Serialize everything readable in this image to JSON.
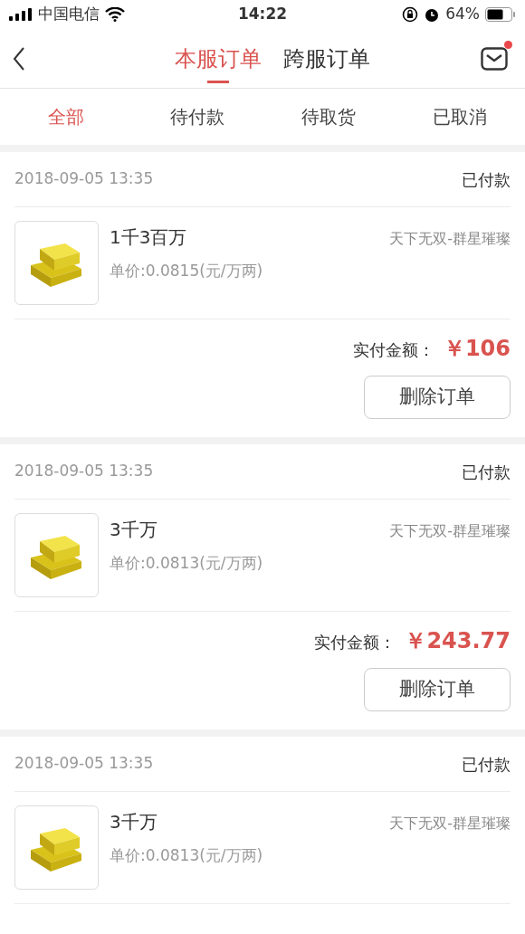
{
  "status_bar": {
    "carrier": "中国电信",
    "time": "14:22",
    "battery": "64%"
  },
  "header": {
    "tabs": [
      {
        "label": "本服订单",
        "selected": true
      },
      {
        "label": "跨服订单",
        "selected": false
      }
    ],
    "has_unread": true
  },
  "filters": [
    {
      "label": "全部",
      "selected": true
    },
    {
      "label": "待付款",
      "selected": false
    },
    {
      "label": "待取货",
      "selected": false
    },
    {
      "label": "已取消",
      "selected": false
    }
  ],
  "orders": [
    {
      "date": "2018-09-05 13:35",
      "status": "已付款",
      "title": "1千3百万",
      "server": "天下无双-群星璀璨",
      "unit_price": "单价:0.0815(元/万两)",
      "total_label": "实付金额：",
      "total": "￥106",
      "action": "删除订单"
    },
    {
      "date": "2018-09-05 13:35",
      "status": "已付款",
      "title": "3千万",
      "server": "天下无双-群星璀璨",
      "unit_price": "单价:0.0813(元/万两)",
      "total_label": "实付金额：",
      "total": "￥243.77",
      "action": "删除订单"
    },
    {
      "date": "2018-09-05 13:35",
      "status": "已付款",
      "title": "3千万",
      "server": "天下无双-群星璀璨",
      "unit_price": "单价:0.0813(元/万两)"
    }
  ]
}
